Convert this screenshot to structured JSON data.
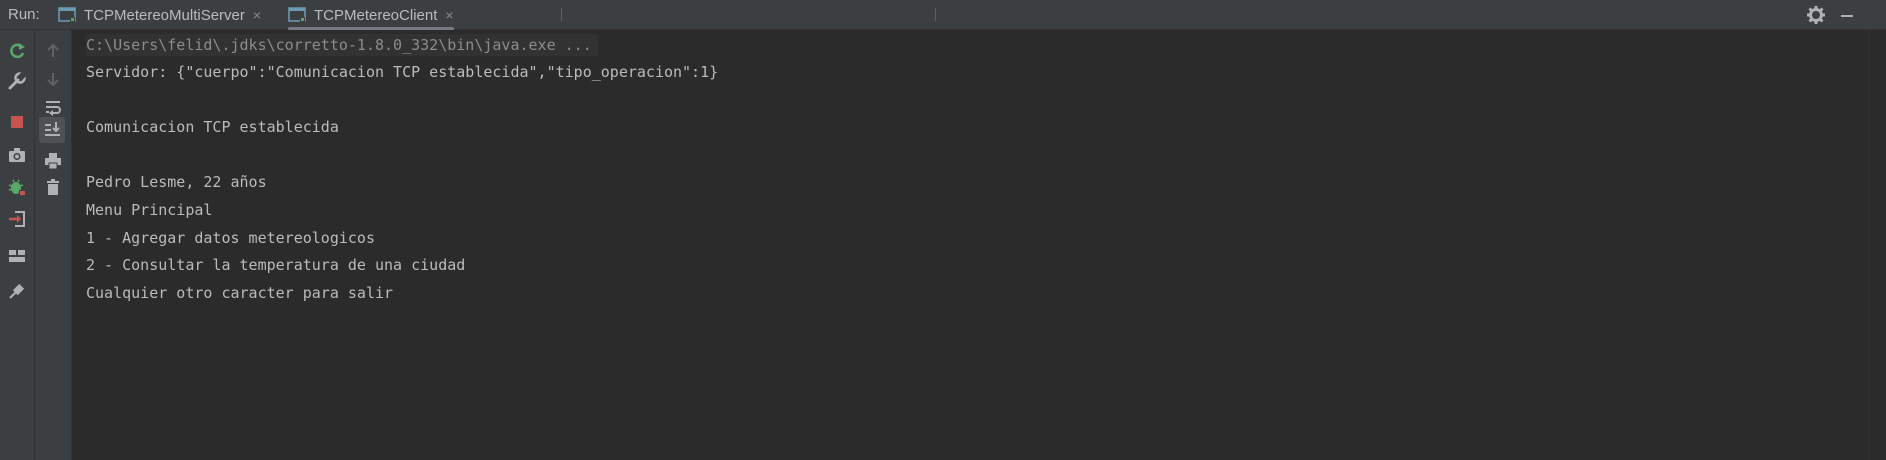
{
  "run_panel": {
    "label": "Run:",
    "tabs": [
      {
        "label": "TCPMetereoMultiServer",
        "active": false
      },
      {
        "label": "TCPMetereoClient",
        "active": true
      }
    ],
    "close_glyph": "×",
    "right_icons": [
      "gear-icon",
      "minimize-icon"
    ]
  },
  "left_toolbar": {
    "icons": [
      "rerun-icon",
      "wrench-icon",
      "stop-icon",
      "camera-icon",
      "debug-bug-icon",
      "exit-icon",
      "layout-icon",
      "pin-icon"
    ]
  },
  "second_toolbar": {
    "icons": [
      "arrow-up-icon",
      "arrow-down-icon",
      "soft-wrap-icon",
      "scroll-to-end-icon",
      "print-icon",
      "trash-icon"
    ]
  },
  "console": {
    "lines": [
      "C:\\Users\\felid\\.jdks\\corretto-1.8.0_332\\bin\\java.exe ...",
      "Servidor: {\"cuerpo\":\"Comunicacion TCP establecida\",\"tipo_operacion\":1}",
      "",
      "Comunicacion TCP establecida",
      "",
      "Pedro Lesme, 22 años",
      "Menu Principal",
      "1 - Agregar datos metereologicos",
      "2 - Consultar la temperatura de una ciudad",
      "Cualquier otro caracter para salir"
    ]
  },
  "colors": {
    "background": "#2b2b2b",
    "panel": "#3c3f41",
    "text": "#bbbbbb",
    "rerun_green": "#59a869",
    "stop_red": "#c75450"
  }
}
